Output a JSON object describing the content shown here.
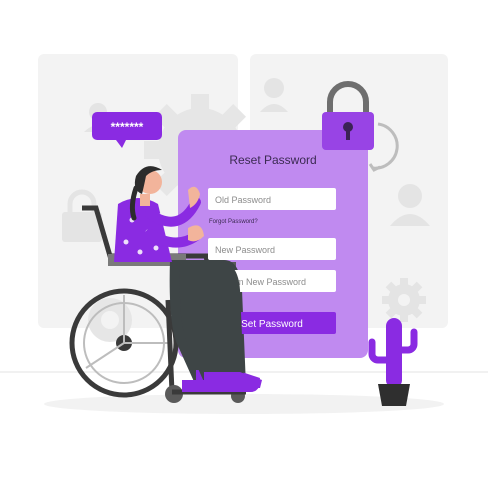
{
  "bubble": {
    "masked_text": "*******"
  },
  "form": {
    "title": "Reset Password",
    "old_password_placeholder": "Old Password",
    "forgot_link": "Forgot Password?",
    "new_password_placeholder": "New Password",
    "confirm_password_placeholder": "Confirm New Password",
    "submit_label": "Set Password"
  },
  "colors": {
    "accent": "#8a2be2",
    "accent_light": "#c08af0",
    "background_grey": "#f0f0f0"
  },
  "icons": [
    "padlock-icon",
    "gear-icon",
    "user-icon",
    "cactus-icon",
    "wheelchair-icon"
  ]
}
